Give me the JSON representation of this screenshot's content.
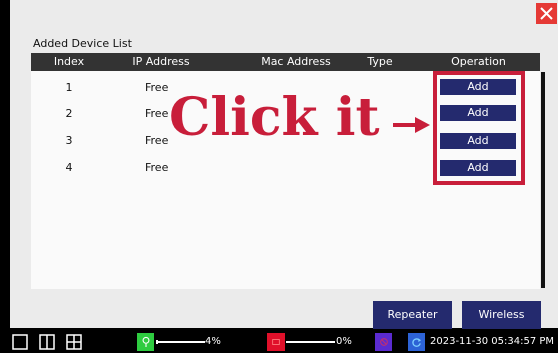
{
  "device_list": {
    "title": "Added Device List",
    "columns": [
      "Index",
      "IP Address",
      "Mac Address",
      "Type",
      "Operation"
    ],
    "rows": [
      {
        "index": "1",
        "ip": "Free",
        "mac": "",
        "type": "",
        "operation": "Add"
      },
      {
        "index": "2",
        "ip": "Free",
        "mac": "",
        "type": "",
        "operation": "Add"
      },
      {
        "index": "3",
        "ip": "Free",
        "mac": "",
        "type": "",
        "operation": "Add"
      },
      {
        "index": "4",
        "ip": "Free",
        "mac": "",
        "type": "",
        "operation": "Add"
      }
    ]
  },
  "annotation": {
    "text": "Click it",
    "color": "#c81e3a"
  },
  "buttons": {
    "repeater": "Repeater",
    "wireless_status": "Wireless status"
  },
  "taskbar": {
    "storage_percent": 4,
    "storage_label": "4%",
    "record_percent": 0,
    "record_label": "0%",
    "datetime": "2023-11-30 05:34:57 PM"
  },
  "colors": {
    "accent_button": "#242a6e",
    "close": "#e53935",
    "header": "#333333"
  },
  "icons": [
    "close-icon",
    "single-view-icon",
    "dual-view-icon",
    "quad-view-icon",
    "location-pin-icon",
    "record-icon",
    "no-signal-icon",
    "refresh-icon"
  ]
}
